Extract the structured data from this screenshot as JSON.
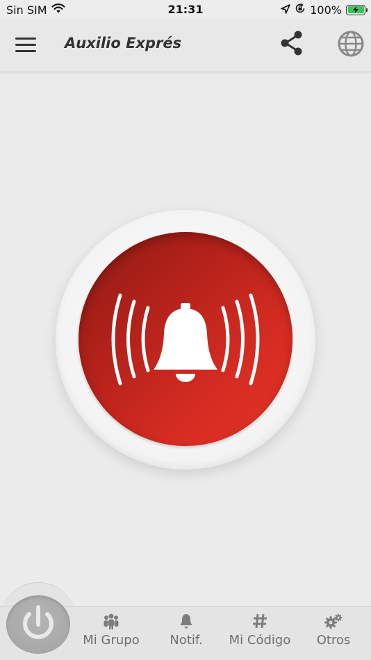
{
  "status_bar": {
    "carrier": "Sin SIM",
    "time": "21:31",
    "battery_percent": "100%",
    "icons": [
      "wifi-icon",
      "location-arrow-icon",
      "orientation-lock-icon",
      "battery-charging-icon"
    ]
  },
  "app_bar": {
    "title": "Auxilio Exprés",
    "icons": [
      "hamburger-menu-icon",
      "share-icon",
      "globe-icon"
    ]
  },
  "alarm": {
    "icon": "alarm-bell-icon",
    "colors": {
      "button": "#c62a1f",
      "ring": "#f5f5f5"
    }
  },
  "tab_bar": {
    "power_icon": "power-icon",
    "tabs": [
      {
        "label": "Mi Grupo",
        "icon": "group-icon"
      },
      {
        "label": "Notif.",
        "icon": "bell-icon"
      },
      {
        "label": "Mi Código",
        "icon": "hash-icon"
      },
      {
        "label": "Otros",
        "icon": "gears-icon"
      }
    ]
  }
}
